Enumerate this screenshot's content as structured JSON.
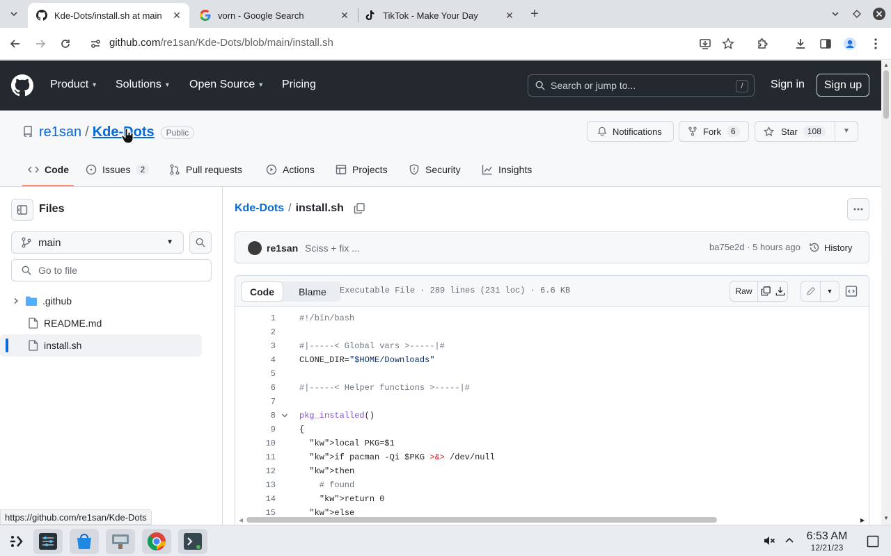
{
  "browser": {
    "tabs": [
      {
        "title": "Kde-Dots/install.sh at main",
        "active": true,
        "icon": "github-icon"
      },
      {
        "title": "vorn - Google Search",
        "active": false,
        "icon": "google-icon"
      },
      {
        "title": "TikTok - Make Your Day",
        "active": false,
        "icon": "tiktok-icon"
      }
    ],
    "url_host": "github.com",
    "url_path": "/re1san/Kde-Dots/blob/main/install.sh"
  },
  "gh_header": {
    "nav": [
      "Product",
      "Solutions",
      "Open Source",
      "Pricing"
    ],
    "search_placeholder": "Search or jump to...",
    "search_key": "/",
    "sign_in": "Sign in",
    "sign_up": "Sign up"
  },
  "repo": {
    "owner": "re1san",
    "separator": "/",
    "name": "Kde-Dots",
    "visibility": "Public",
    "notifications_label": "Notifications",
    "fork_label": "Fork",
    "fork_count": "6",
    "star_label": "Star",
    "star_count": "108",
    "tabs": [
      {
        "label": "Code",
        "count": ""
      },
      {
        "label": "Issues",
        "count": "2"
      },
      {
        "label": "Pull requests",
        "count": ""
      },
      {
        "label": "Actions",
        "count": ""
      },
      {
        "label": "Projects",
        "count": ""
      },
      {
        "label": "Security",
        "count": ""
      },
      {
        "label": "Insights",
        "count": ""
      }
    ]
  },
  "sidebar": {
    "title": "Files",
    "branch": "main",
    "goto_placeholder": "Go to file",
    "items": [
      {
        "name": ".github",
        "type": "folder"
      },
      {
        "name": "README.md",
        "type": "file"
      },
      {
        "name": "install.sh",
        "type": "file",
        "selected": true
      }
    ]
  },
  "file": {
    "repo_link": "Kde-Dots",
    "separator": "/",
    "name": "install.sh",
    "commit_author": "re1san",
    "commit_message": "Sciss + fix ...",
    "commit_meta": "ba75e2d · 5 hours ago",
    "history_label": "History",
    "view_tabs": [
      "Code",
      "Blame"
    ],
    "info": "Executable File · 289 lines (231 loc) · 6.6 KB",
    "raw_label": "Raw"
  },
  "code_lines": [
    {
      "n": "1",
      "text": "#!/bin/bash"
    },
    {
      "n": "2",
      "text": ""
    },
    {
      "n": "3",
      "text": "#|-----< Global vars >-----|#"
    },
    {
      "n": "4",
      "text": "CLONE_DIR=\"$HOME/Downloads\""
    },
    {
      "n": "5",
      "text": ""
    },
    {
      "n": "6",
      "text": "#|-----< Helper functions >-----|#"
    },
    {
      "n": "7",
      "text": ""
    },
    {
      "n": "8",
      "text": "pkg_installed()"
    },
    {
      "n": "9",
      "text": "{"
    },
    {
      "n": "10",
      "text": "  local PKG=$1"
    },
    {
      "n": "11",
      "text": "  if pacman -Qi $PKG &> /dev/null"
    },
    {
      "n": "12",
      "text": "  then"
    },
    {
      "n": "13",
      "text": "    # found"
    },
    {
      "n": "14",
      "text": "    return 0"
    },
    {
      "n": "15",
      "text": "  else"
    }
  ],
  "status_url": "https://github.com/re1san/Kde-Dots",
  "taskbar": {
    "time": "6:53 AM",
    "date": "12/21/23"
  }
}
